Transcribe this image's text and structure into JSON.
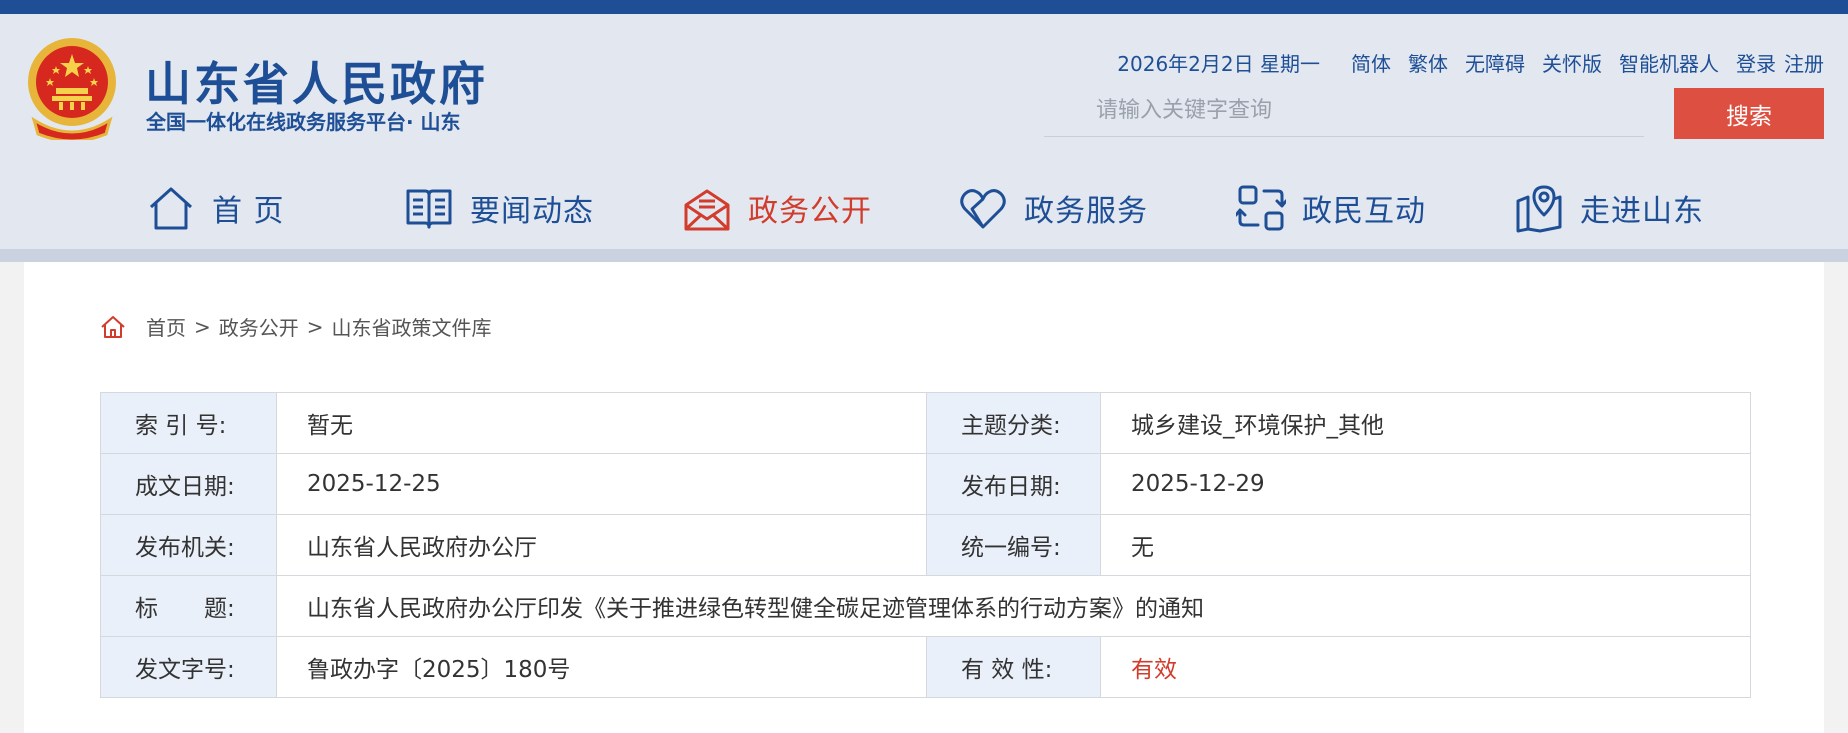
{
  "header": {
    "site_title": "山东省人民政府",
    "site_subtitle": "全国一体化在线政务服务平台· 山东",
    "date": "2026年2月2日 星期一",
    "links": [
      "简体",
      "繁体",
      "无障碍",
      "关怀版",
      "智能机器人"
    ],
    "login": "登录",
    "register": "注册",
    "search": {
      "placeholder": "请输入关键字查询",
      "button": "搜索"
    }
  },
  "nav": {
    "items": [
      {
        "label": "首 页",
        "icon": "home-icon"
      },
      {
        "label": "要闻动态",
        "icon": "book-icon"
      },
      {
        "label": "政务公开",
        "icon": "mail-icon",
        "active": true
      },
      {
        "label": "政务服务",
        "icon": "heart-icon"
      },
      {
        "label": "政民互动",
        "icon": "exchange-icon"
      },
      {
        "label": "走进山东",
        "icon": "map-pin-icon"
      }
    ]
  },
  "breadcrumb": [
    "首页",
    "政务公开",
    "山东省政策文件库"
  ],
  "meta": {
    "index_no_label": "索 引 号:",
    "index_no": "暂无",
    "topic_label": "主题分类:",
    "topic": "城乡建设_环境保护_其他",
    "written_label": "成文日期:",
    "written": "2025-12-25",
    "published_label": "发布日期:",
    "published": "2025-12-29",
    "issuer_label": "发布机关:",
    "issuer": "山东省人民政府办公厅",
    "serial_label": "统一编号:",
    "serial": "无",
    "title_label": "标　　题:",
    "title": "山东省人民政府办公厅印发《关于推进绿色转型健全碳足迹管理体系的行动方案》的通知",
    "doc_no_label": "发文字号:",
    "doc_no": "鲁政办字〔2025〕180号",
    "validity_label": "有 效 性:",
    "validity": "有效"
  },
  "colors": {
    "brand_blue": "#1e4f96",
    "accent_red": "#d23c2c",
    "search_button": "#dd4f41",
    "key_cell_bg": "#e9f0f9"
  }
}
